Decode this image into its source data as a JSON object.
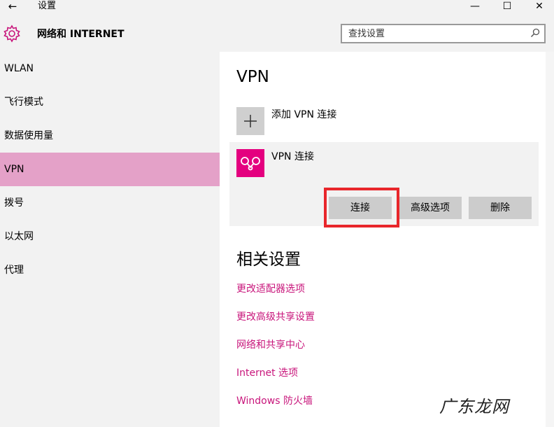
{
  "titlebar": {
    "back_glyph": "←",
    "app_title": "设置",
    "minimize_glyph": "—",
    "maximize_glyph": "☐",
    "close_glyph": "✕"
  },
  "header": {
    "title": "网络和 INTERNET",
    "icon": "gear-icon",
    "search_placeholder": "查找设置",
    "search_icon": "search-icon"
  },
  "sidebar": {
    "items": [
      {
        "label": "WLAN",
        "selected": false
      },
      {
        "label": "飞行模式",
        "selected": false
      },
      {
        "label": "数据使用量",
        "selected": false
      },
      {
        "label": "VPN",
        "selected": true
      },
      {
        "label": "拨号",
        "selected": false
      },
      {
        "label": "以太网",
        "selected": false
      },
      {
        "label": "代理",
        "selected": false
      }
    ],
    "selected_color": "#e4a1c8"
  },
  "main": {
    "vpn_title": "VPN",
    "add_vpn_label": "添加 VPN 连接",
    "add_icon": "plus-icon",
    "vpn_connection": {
      "name": "VPN 连接",
      "icon": "vpn-icon",
      "tile_color": "#e4007f",
      "buttons": {
        "connect": "连接",
        "advanced": "高级选项",
        "delete": "删除"
      }
    },
    "related_title": "相关设置",
    "related_links": [
      "更改适配器选项",
      "更改高级共享设置",
      "网络和共享中心",
      "Internet 选项",
      "Windows 防火墙"
    ],
    "link_color": "#c8157b"
  },
  "annotation": {
    "highlight_color": "#e8262b"
  },
  "watermark": "广东龙网"
}
